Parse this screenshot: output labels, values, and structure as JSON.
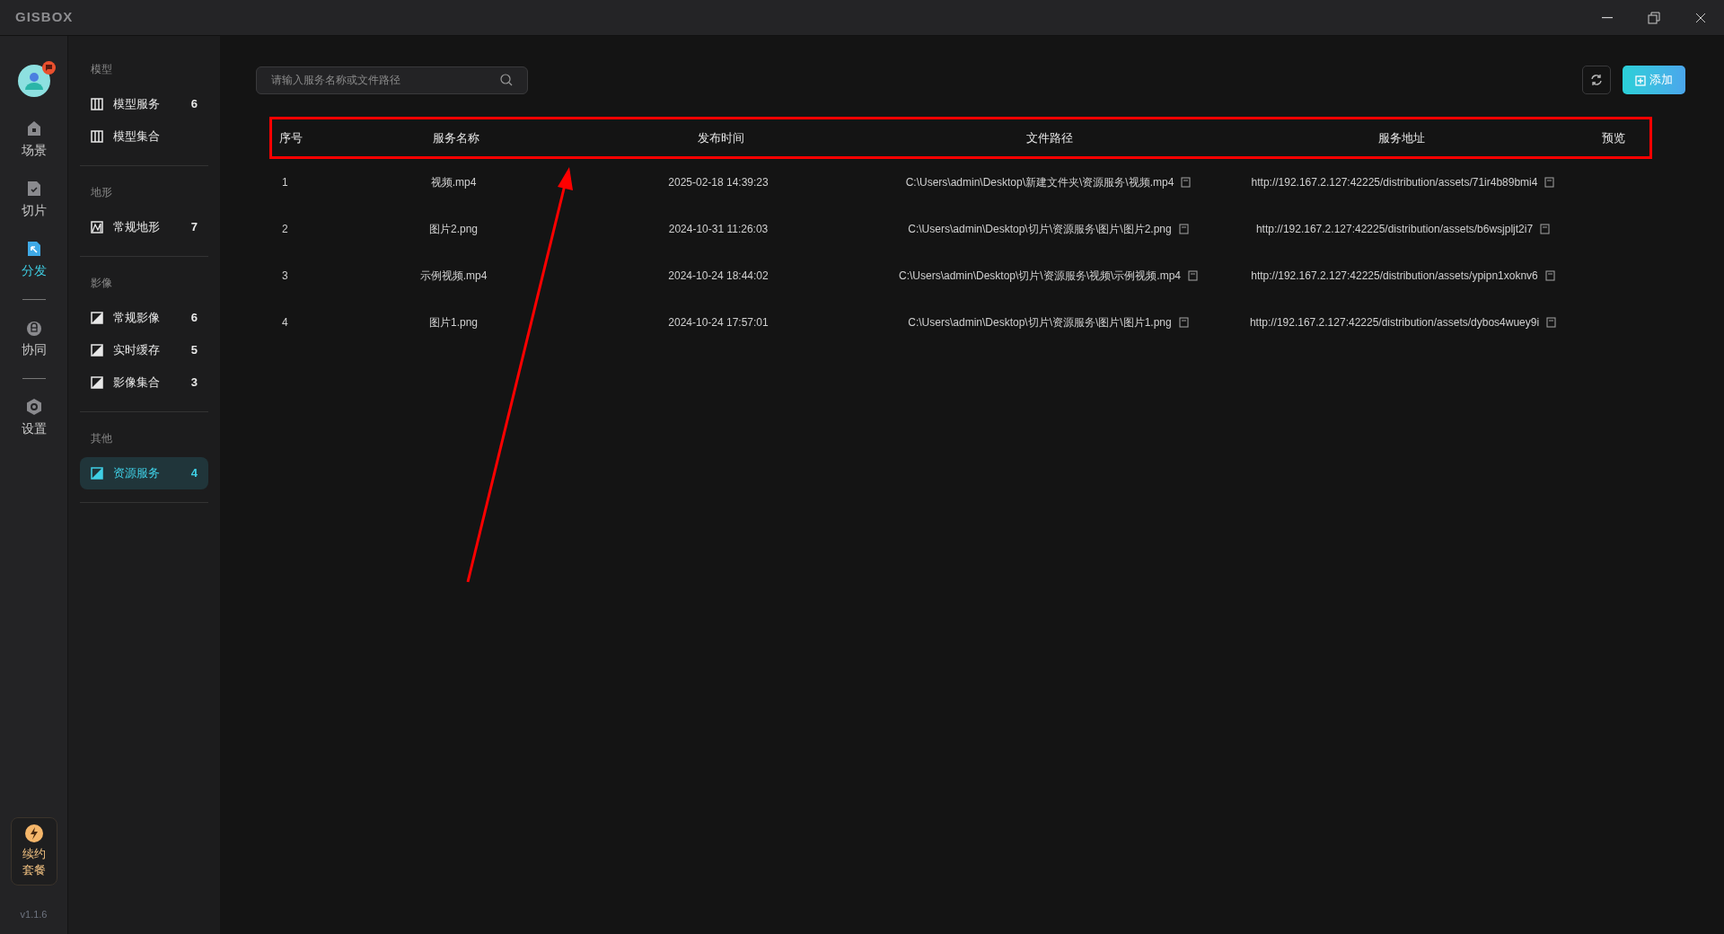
{
  "window": {
    "logo": "GISBOX"
  },
  "rail": {
    "groups": [
      [
        {
          "label": "场景",
          "selected": false
        },
        {
          "label": "切片",
          "selected": false
        },
        {
          "label": "分发",
          "selected": true
        }
      ],
      [
        {
          "label": "协同",
          "selected": false
        }
      ],
      [
        {
          "label": "设置",
          "selected": false
        }
      ]
    ],
    "renew": "续约套餐",
    "version": "v1.1.6"
  },
  "sidebar": {
    "groups": [
      {
        "title": "模型",
        "items": [
          {
            "label": "模型服务",
            "count": "6",
            "selected": false
          },
          {
            "label": "模型集合",
            "selected": false
          }
        ]
      },
      {
        "title": "地形",
        "items": [
          {
            "label": "常规地形",
            "count": "7",
            "selected": false
          }
        ]
      },
      {
        "title": "影像",
        "items": [
          {
            "label": "常规影像",
            "count": "6",
            "selected": false
          },
          {
            "label": "实时缓存",
            "count": "5",
            "selected": false
          },
          {
            "label": "影像集合",
            "count": "3",
            "selected": false
          }
        ]
      },
      {
        "title": "其他",
        "items": [
          {
            "label": "资源服务",
            "count": "4",
            "selected": true
          }
        ]
      }
    ]
  },
  "search": {
    "placeholder": "请输入服务名称或文件路径"
  },
  "add_button": "添加",
  "table": {
    "highlighted": true,
    "columns": [
      "序号",
      "服务名称",
      "发布时间",
      "文件路径",
      "服务地址",
      "预览"
    ],
    "rows": [
      {
        "cells": [
          "1",
          "视频.mp4",
          "2025-02-18 14:39:23",
          "C:\\Users\\admin\\Desktop\\新建文件夹\\资源服务\\视频.mp4",
          "http://192.167.2.127:42225/distribution/assets/71ir4b89bmi4"
        ]
      },
      {
        "cells": [
          "2",
          "图片2.png",
          "2024-10-31 11:26:03",
          "C:\\Users\\admin\\Desktop\\切片\\资源服务\\图片\\图片2.png",
          "http://192.167.2.127:42225/distribution/assets/b6wsjpljt2i7"
        ]
      },
      {
        "cells": [
          "3",
          "示例视频.mp4",
          "2024-10-24 18:44:02",
          "C:\\Users\\admin\\Desktop\\切片\\资源服务\\视频\\示例视频.mp4",
          "http://192.167.2.127:42225/distribution/assets/ypipn1xoknv6"
        ]
      },
      {
        "cells": [
          "4",
          "图片1.png",
          "2024-10-24 17:57:01",
          "C:\\Users\\admin\\Desktop\\切片\\资源服务\\图片\\图片1.png",
          "http://192.167.2.127:42225/distribution/assets/dybos4wuey9i"
        ]
      }
    ]
  },
  "annotation": {
    "arrow": true
  }
}
